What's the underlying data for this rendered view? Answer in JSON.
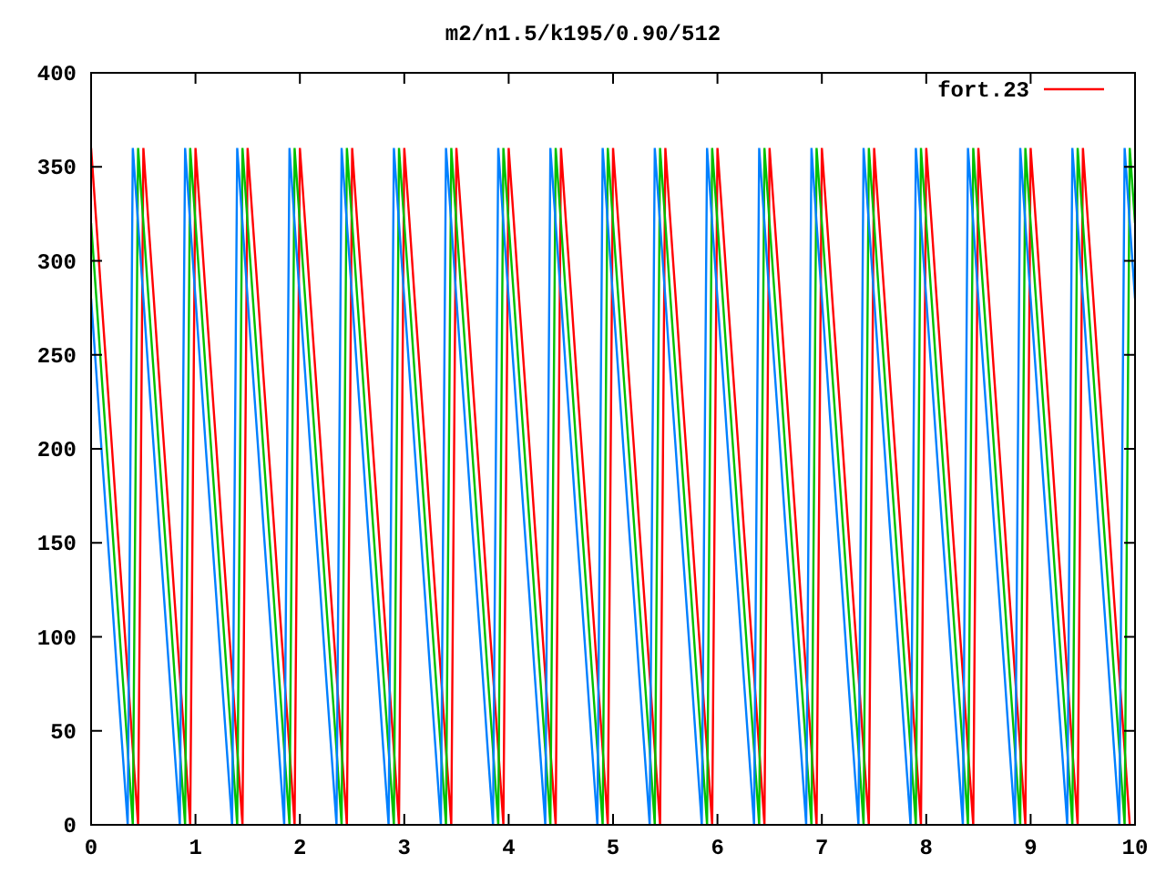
{
  "chart_data": {
    "type": "line",
    "title": "m2/n1.5/k195/0.90/512",
    "xlim": [
      0,
      10
    ],
    "ylim": [
      0,
      400
    ],
    "xticks": [
      0,
      1,
      2,
      3,
      4,
      5,
      6,
      7,
      8,
      9,
      10
    ],
    "yticks": [
      0,
      50,
      100,
      150,
      200,
      250,
      300,
      350,
      400
    ],
    "x": [
      0,
      0.05,
      0.1,
      0.15,
      0.2,
      0.25,
      0.3,
      0.35,
      0.4,
      0.45,
      0.5,
      0.55,
      0.6,
      0.65,
      0.7,
      0.75,
      0.8,
      0.85,
      0.9,
      0.95,
      1,
      1.05,
      1.1,
      1.15,
      1.2,
      1.25,
      1.3,
      1.35,
      1.4,
      1.45,
      1.5,
      1.55,
      1.6,
      1.65,
      1.7,
      1.75,
      1.8,
      1.85,
      1.9,
      1.95,
      2,
      2.05,
      2.1,
      2.15,
      2.2,
      2.25,
      2.3,
      2.35,
      2.4,
      2.45,
      2.5,
      2.55,
      2.6,
      2.65,
      2.7,
      2.75,
      2.8,
      2.85,
      2.9,
      2.95,
      3,
      3.05,
      3.1,
      3.15,
      3.2,
      3.25,
      3.3,
      3.35,
      3.4,
      3.45,
      3.5,
      3.55,
      3.6,
      3.65,
      3.7,
      3.75,
      3.8,
      3.85,
      3.9,
      3.95,
      4,
      4.05,
      4.1,
      4.15,
      4.2,
      4.25,
      4.3,
      4.35,
      4.4,
      4.45,
      4.5,
      4.55,
      4.6,
      4.65,
      4.7,
      4.75,
      4.8,
      4.85,
      4.9,
      4.95,
      5,
      5.05,
      5.1,
      5.15,
      5.2,
      5.25,
      5.3,
      5.35,
      5.4,
      5.45,
      5.5,
      5.55,
      5.6,
      5.65,
      5.7,
      5.75,
      5.8,
      5.85,
      5.9,
      5.95,
      6,
      6.05,
      6.1,
      6.15,
      6.2,
      6.25,
      6.3,
      6.35,
      6.4,
      6.45,
      6.5,
      6.55,
      6.6,
      6.65,
      6.7,
      6.75,
      6.8,
      6.85,
      6.9,
      6.95,
      7,
      7.05,
      7.1,
      7.15,
      7.2,
      7.25,
      7.3,
      7.35,
      7.4,
      7.45,
      7.5,
      7.55,
      7.6,
      7.65,
      7.7,
      7.75,
      7.8,
      7.85,
      7.9,
      7.95,
      8,
      8.05,
      8.1,
      8.15,
      8.2,
      8.25,
      8.3,
      8.35,
      8.4,
      8.45,
      8.5,
      8.55,
      8.6,
      8.65,
      8.7,
      8.75,
      8.8,
      8.85,
      8.9,
      8.95,
      9,
      9.05,
      9.1,
      9.15,
      9.2,
      9.25,
      9.3,
      9.35,
      9.4,
      9.45,
      9.5,
      9.55,
      9.6,
      9.65,
      9.7,
      9.75,
      9.8,
      9.85,
      9.9,
      9.95,
      10
    ],
    "series": [
      {
        "name": "fort.23",
        "color": "#ff0000",
        "values": [
          360,
          320,
          280,
          240,
          200,
          160,
          120,
          80,
          40,
          0,
          360,
          320,
          280,
          240,
          200,
          160,
          120,
          80,
          40,
          0,
          360,
          320,
          280,
          240,
          200,
          160,
          120,
          80,
          40,
          0,
          360,
          320,
          280,
          240,
          200,
          160,
          120,
          80,
          40,
          0,
          360,
          320,
          280,
          240,
          200,
          160,
          120,
          80,
          40,
          0,
          360,
          320,
          280,
          240,
          200,
          160,
          120,
          80,
          40,
          0,
          360,
          320,
          280,
          240,
          200,
          160,
          120,
          80,
          40,
          0,
          360,
          320,
          280,
          240,
          200,
          160,
          120,
          80,
          40,
          0,
          360,
          320,
          280,
          240,
          200,
          160,
          120,
          80,
          40,
          0,
          360,
          320,
          280,
          240,
          200,
          160,
          120,
          80,
          40,
          0,
          360,
          320,
          280,
          240,
          200,
          160,
          120,
          80,
          40,
          0,
          360,
          320,
          280,
          240,
          200,
          160,
          120,
          80,
          40,
          0,
          360,
          320,
          280,
          240,
          200,
          160,
          120,
          80,
          40,
          0,
          360,
          320,
          280,
          240,
          200,
          160,
          120,
          80,
          40,
          0,
          360,
          320,
          280,
          240,
          200,
          160,
          120,
          80,
          40,
          0,
          360,
          320,
          280,
          240,
          200,
          160,
          120,
          80,
          40,
          0,
          360,
          320,
          280,
          240,
          200,
          160,
          120,
          80,
          40,
          0,
          360,
          320,
          280,
          240,
          200,
          160,
          120,
          80,
          40,
          0,
          360,
          320,
          280,
          240,
          200,
          160,
          120,
          80,
          40,
          0,
          360,
          320,
          280,
          240,
          200,
          160,
          120,
          80,
          40,
          0,
          null
        ]
      },
      {
        "color": "#00c000",
        "values": [
          320,
          280,
          240,
          200,
          160,
          120,
          80,
          40,
          0,
          360,
          320,
          280,
          240,
          200,
          160,
          120,
          80,
          40,
          0,
          360,
          320,
          280,
          240,
          200,
          160,
          120,
          80,
          40,
          0,
          360,
          320,
          280,
          240,
          200,
          160,
          120,
          80,
          40,
          0,
          360,
          320,
          280,
          240,
          200,
          160,
          120,
          80,
          40,
          0,
          360,
          320,
          280,
          240,
          200,
          160,
          120,
          80,
          40,
          0,
          360,
          320,
          280,
          240,
          200,
          160,
          120,
          80,
          40,
          0,
          360,
          320,
          280,
          240,
          200,
          160,
          120,
          80,
          40,
          0,
          360,
          320,
          280,
          240,
          200,
          160,
          120,
          80,
          40,
          0,
          360,
          320,
          280,
          240,
          200,
          160,
          120,
          80,
          40,
          0,
          360,
          320,
          280,
          240,
          200,
          160,
          120,
          80,
          40,
          0,
          360,
          320,
          280,
          240,
          200,
          160,
          120,
          80,
          40,
          0,
          360,
          320,
          280,
          240,
          200,
          160,
          120,
          80,
          40,
          0,
          360,
          320,
          280,
          240,
          200,
          160,
          120,
          80,
          40,
          0,
          360,
          320,
          280,
          240,
          200,
          160,
          120,
          80,
          40,
          0,
          360,
          320,
          280,
          240,
          200,
          160,
          120,
          80,
          40,
          0,
          360,
          320,
          280,
          240,
          200,
          160,
          120,
          80,
          40,
          0,
          360,
          320,
          280,
          240,
          200,
          160,
          120,
          80,
          40,
          0,
          360,
          320,
          280,
          240,
          200,
          160,
          120,
          80,
          40,
          0,
          360,
          320,
          280,
          240,
          200,
          160,
          120,
          80,
          40,
          0,
          360,
          320
        ]
      },
      {
        "color": "#0080ff",
        "values": [
          280,
          240,
          200,
          160,
          120,
          80,
          40,
          0,
          360,
          320,
          280,
          240,
          200,
          160,
          120,
          80,
          40,
          0,
          360,
          320,
          280,
          240,
          200,
          160,
          120,
          80,
          40,
          0,
          360,
          320,
          280,
          240,
          200,
          160,
          120,
          80,
          40,
          0,
          360,
          320,
          280,
          240,
          200,
          160,
          120,
          80,
          40,
          0,
          360,
          320,
          280,
          240,
          200,
          160,
          120,
          80,
          40,
          0,
          360,
          320,
          280,
          240,
          200,
          160,
          120,
          80,
          40,
          0,
          360,
          320,
          280,
          240,
          200,
          160,
          120,
          80,
          40,
          0,
          360,
          320,
          280,
          240,
          200,
          160,
          120,
          80,
          40,
          0,
          360,
          320,
          280,
          240,
          200,
          160,
          120,
          80,
          40,
          0,
          360,
          320,
          280,
          240,
          200,
          160,
          120,
          80,
          40,
          0,
          360,
          320,
          280,
          240,
          200,
          160,
          120,
          80,
          40,
          0,
          360,
          320,
          280,
          240,
          200,
          160,
          120,
          80,
          40,
          0,
          360,
          320,
          280,
          240,
          200,
          160,
          120,
          80,
          40,
          0,
          360,
          320,
          280,
          240,
          200,
          160,
          120,
          80,
          40,
          0,
          360,
          320,
          280,
          240,
          200,
          160,
          120,
          80,
          40,
          0,
          360,
          320,
          280,
          240,
          200,
          160,
          120,
          80,
          40,
          0,
          360,
          320,
          280,
          240,
          200,
          160,
          120,
          80,
          40,
          0,
          360,
          320,
          280,
          240,
          200,
          160,
          120,
          80,
          40,
          0,
          360,
          320,
          280,
          240,
          200,
          160,
          120,
          80,
          40,
          0,
          360,
          320,
          280
        ]
      }
    ]
  }
}
